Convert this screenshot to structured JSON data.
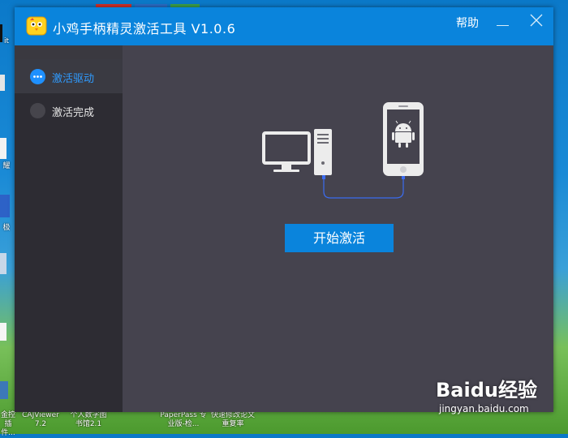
{
  "window": {
    "title": "小鸡手柄精灵激活工具 V1.0.6",
    "help_label": "帮助"
  },
  "sidebar": {
    "items": [
      {
        "label": "激活驱动",
        "active": true
      },
      {
        "label": "激活完成",
        "active": false
      }
    ]
  },
  "main": {
    "start_button": "开始激活"
  },
  "desktop": {
    "icons": [
      {
        "label": "CAJViewer 7.2"
      },
      {
        "label": "个人数字图书馆2.1"
      },
      {
        "label": "PaperPass 专业版-检..."
      },
      {
        "label": "快速修改论文重复率"
      },
      {
        "label": "金控 插件..."
      }
    ],
    "edge_labels": [
      "it",
      "耀",
      "极"
    ]
  },
  "watermark": {
    "brand": "Baidu经验",
    "url": "jingyan.baidu.com"
  },
  "colors": {
    "accent": "#0a84dc",
    "window_bg": "#45434e",
    "sidebar_bg": "#2d2c33",
    "usb_cable": "#3b6cf0"
  }
}
